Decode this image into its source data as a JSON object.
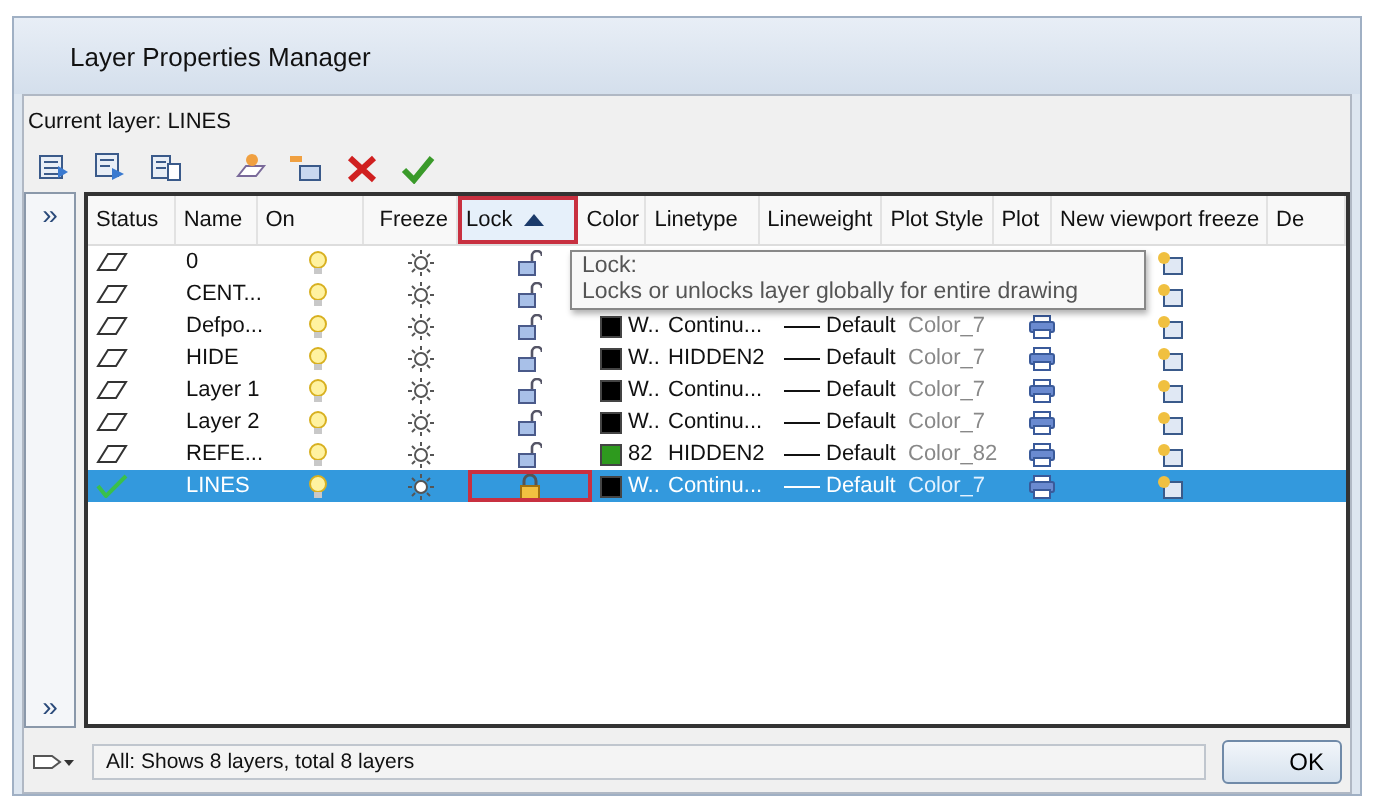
{
  "window": {
    "title": "Layer Properties Manager"
  },
  "current_layer": "Current layer: LINES",
  "toolbar": [
    {
      "kind": "new-filter"
    },
    {
      "kind": "group-filter"
    },
    {
      "kind": "states"
    },
    {
      "kind": "new-layer"
    },
    {
      "kind": "new-vp-layer"
    },
    {
      "kind": "delete"
    },
    {
      "kind": "set-current"
    }
  ],
  "side_panel": {
    "top": "»",
    "bottom": "»"
  },
  "table": {
    "columns": [
      {
        "label": "Status",
        "sorted": false,
        "highlighted": false
      },
      {
        "label": "Name",
        "sorted": false,
        "highlighted": false
      },
      {
        "label": "On",
        "sorted": false,
        "highlighted": false
      },
      {
        "label": "Freeze",
        "sorted": false,
        "highlighted": false
      },
      {
        "label": "Lock",
        "sorted": true,
        "highlighted": true
      },
      {
        "label": "Color",
        "sorted": false,
        "highlighted": false
      },
      {
        "label": "Linetype",
        "sorted": false,
        "highlighted": false
      },
      {
        "label": "Lineweight",
        "sorted": false,
        "highlighted": false
      },
      {
        "label": "Plot Style",
        "sorted": false,
        "highlighted": false
      },
      {
        "label": "Plot",
        "sorted": false,
        "highlighted": false
      },
      {
        "label": "New viewport freeze",
        "sorted": false,
        "highlighted": false
      },
      {
        "label": "De",
        "sorted": false,
        "highlighted": false
      }
    ],
    "rows": [
      {
        "kind": "layer",
        "name": "0",
        "locked": false,
        "lock_highlighted": false,
        "selected": false
      },
      {
        "kind": "layer",
        "name": "CENT...",
        "locked": false,
        "lock_highlighted": false,
        "selected": false
      },
      {
        "kind": "layer",
        "name": "Defpo...",
        "locked": false,
        "lock_highlighted": false,
        "selected": false,
        "color": "#000000",
        "color_text": "W..",
        "linetype": "Continu...",
        "lineweight": "Default",
        "plot_style": "Color_7"
      },
      {
        "kind": "layer",
        "name": "HIDE",
        "locked": false,
        "lock_highlighted": false,
        "selected": false,
        "color": "#000000",
        "color_text": "W..",
        "linetype": "HIDDEN2",
        "lineweight": "Default",
        "plot_style": "Color_7"
      },
      {
        "kind": "layer",
        "name": "Layer 1",
        "locked": false,
        "lock_highlighted": false,
        "selected": false,
        "color": "#000000",
        "color_text": "W..",
        "linetype": "Continu...",
        "lineweight": "Default",
        "plot_style": "Color_7"
      },
      {
        "kind": "layer",
        "name": "Layer 2",
        "locked": false,
        "lock_highlighted": false,
        "selected": false,
        "color": "#000000",
        "color_text": "W..",
        "linetype": "Continu...",
        "lineweight": "Default",
        "plot_style": "Color_7"
      },
      {
        "kind": "layer",
        "name": "REFE...",
        "locked": false,
        "lock_highlighted": false,
        "selected": false,
        "color": "#2e9a1e",
        "color_text": "82",
        "linetype": "HIDDEN2",
        "lineweight": "Default",
        "plot_style": "Color_82"
      },
      {
        "kind": "current",
        "name": "LINES",
        "locked": true,
        "lock_highlighted": true,
        "selected": true,
        "color": "#000000",
        "color_text": "W..",
        "linetype": "Continu...",
        "lineweight": "Default",
        "plot_style": "Color_7"
      }
    ]
  },
  "tooltip": {
    "title": "Lock:",
    "text": "Locks or unlocks layer globally for entire drawing"
  },
  "status_bar": {
    "text": "All: Shows 8 layers, total 8 layers"
  },
  "buttons": [
    "OK"
  ]
}
